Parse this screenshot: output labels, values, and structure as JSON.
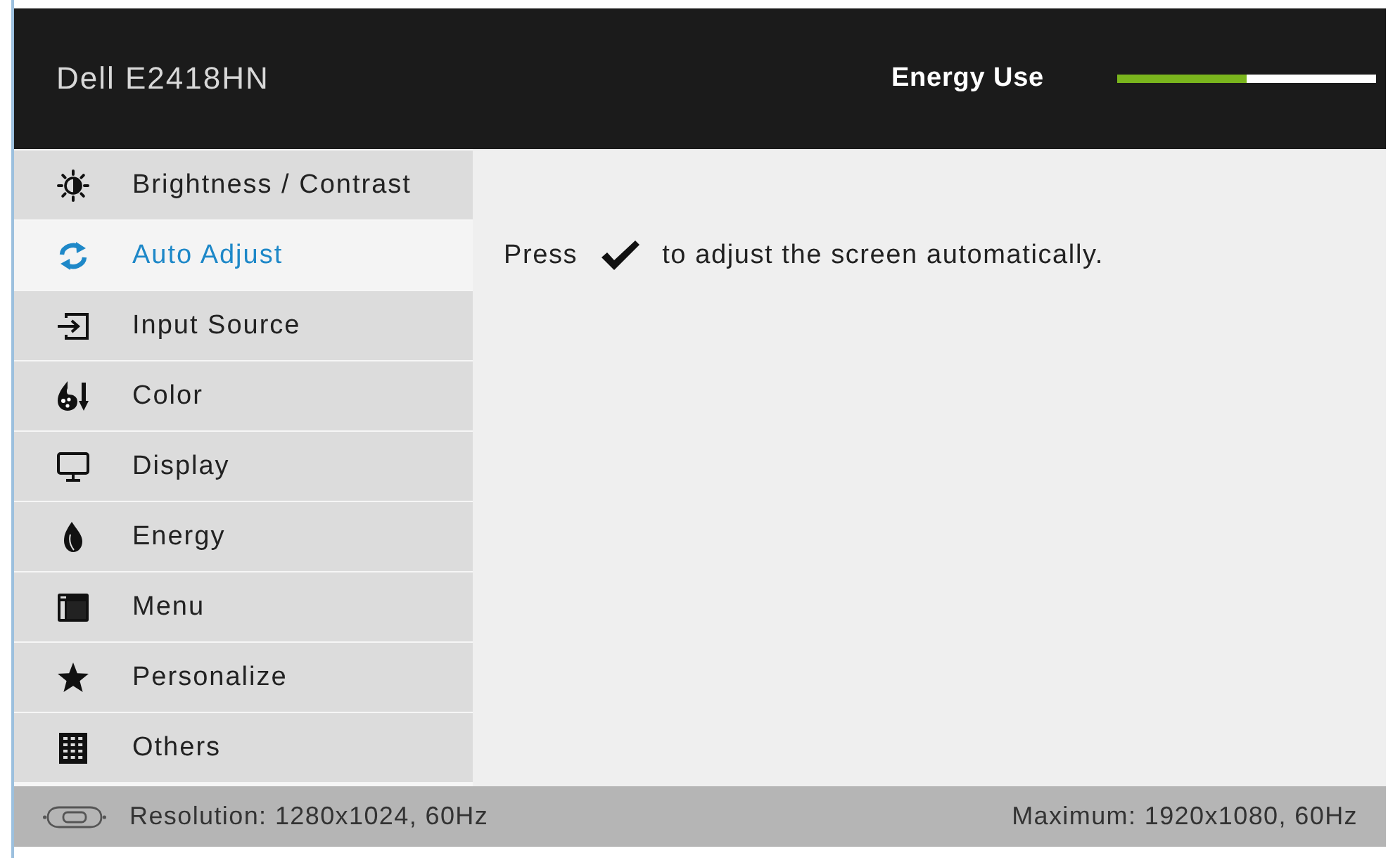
{
  "header": {
    "model": "Dell E2418HN",
    "energy_label": "Energy Use",
    "energy_meter": {
      "level": 0.5
    }
  },
  "menu": {
    "items": [
      {
        "label": "Brightness / Contrast",
        "kind": "brightness",
        "selected": false
      },
      {
        "label": "Auto Adjust",
        "kind": "auto",
        "selected": true
      },
      {
        "label": "Input Source",
        "kind": "input",
        "selected": false
      },
      {
        "label": "Color",
        "kind": "color",
        "selected": false
      },
      {
        "label": "Display",
        "kind": "display",
        "selected": false
      },
      {
        "label": "Energy",
        "kind": "energy",
        "selected": false
      },
      {
        "label": "Menu",
        "kind": "menu",
        "selected": false
      },
      {
        "label": "Personalize",
        "kind": "personalize",
        "selected": false
      },
      {
        "label": "Others",
        "kind": "others",
        "selected": false
      }
    ]
  },
  "content": {
    "message_before": "Press",
    "message_after": "to adjust the screen automatically."
  },
  "status_bar": {
    "resolution": "Resolution: 1280x1024, 60Hz",
    "maximum": "Maximum: 1920x1080, 60Hz"
  }
}
